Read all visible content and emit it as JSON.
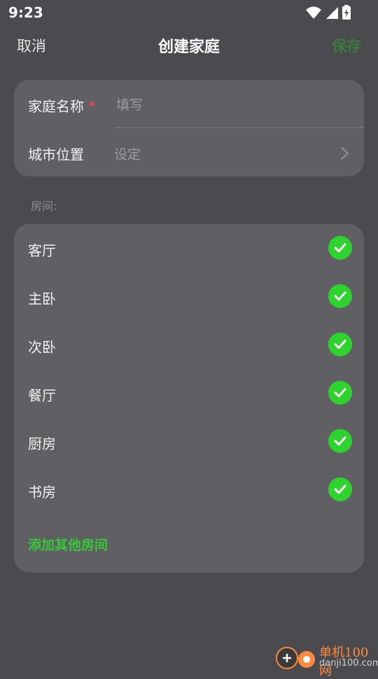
{
  "status_bar": {
    "time": "9:23"
  },
  "nav": {
    "cancel": "取消",
    "title": "创建家庭",
    "save": "保存"
  },
  "form": {
    "name_label": "家庭名称",
    "required_mark": "*",
    "name_placeholder": "填写",
    "city_label": "城市位置",
    "city_value": "设定"
  },
  "rooms_section": {
    "label": "房间:",
    "items": [
      {
        "name": "客厅",
        "checked": true
      },
      {
        "name": "主卧",
        "checked": true
      },
      {
        "name": "次卧",
        "checked": true
      },
      {
        "name": "餐厅",
        "checked": true
      },
      {
        "name": "厨房",
        "checked": true
      },
      {
        "name": "书房",
        "checked": true
      }
    ],
    "add_label": "添加其他房间"
  },
  "watermark": {
    "text": "单机100网",
    "url": "danji100.com"
  },
  "colors": {
    "accent": "#2ed32e",
    "save_disabled": "#3d7a3d",
    "background": "#4a4a4f",
    "card": "#5f5f64"
  }
}
